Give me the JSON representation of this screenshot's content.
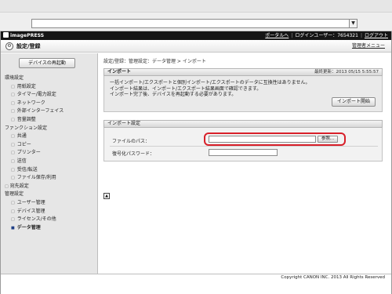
{
  "header": {
    "brand": "imagePRESS",
    "portal_link": "ポータルへ",
    "login_label": "ログインユーザー：7654321",
    "logout_link": "ログアウト"
  },
  "titlebar": {
    "title": "設定/登録",
    "admin_menu": "管理者メニュー"
  },
  "sidebar": {
    "restart_button": "デバイスの再起動",
    "items": [
      {
        "label": "環境設定",
        "level": 0
      },
      {
        "label": "用紙設定",
        "level": 1
      },
      {
        "label": "タイマー/電力設定",
        "level": 1
      },
      {
        "label": "ネットワーク",
        "level": 1
      },
      {
        "label": "外部インターフェイス",
        "level": 1
      },
      {
        "label": "音量調整",
        "level": 1
      },
      {
        "label": "ファンクション設定",
        "level": 0
      },
      {
        "label": "共通",
        "level": 1
      },
      {
        "label": "コピー",
        "level": 1
      },
      {
        "label": "プリンター",
        "level": 1
      },
      {
        "label": "送信",
        "level": 1
      },
      {
        "label": "受信/転送",
        "level": 1
      },
      {
        "label": "ファイル保存/利用",
        "level": 1
      },
      {
        "label": "宛先設定",
        "level": 0
      },
      {
        "label": "管理設定",
        "level": 0
      },
      {
        "label": "ユーザー管理",
        "level": 1
      },
      {
        "label": "デバイス管理",
        "level": 1
      },
      {
        "label": "ライセンス/その他",
        "level": 1
      },
      {
        "label": "データ管理",
        "level": 1,
        "active": true
      }
    ]
  },
  "main": {
    "breadcrumb": "設定/登録：管理設定：データ管理 > インポート",
    "import_panel": {
      "title": "インポート",
      "last_updated": "最終更新：2013 05/15 5:55:57",
      "messages": [
        "一括インポート/エクスポートと個別インポート/エクスポートのデータに互換性はありません。",
        "インポート結果は、インポート/エクスポート結果画面で確認できます。",
        "インポート完了後、デバイスを再起動する必要があります。"
      ],
      "start_button": "インポート開始"
    },
    "settings_panel": {
      "title": "インポート設定",
      "file_path_label": "ファイルのパス：",
      "file_path_value": "",
      "browse_button": "参照...",
      "password_label": "復号化パスワード：",
      "password_value": ""
    },
    "top_button": "▲"
  },
  "footer": {
    "copyright": "Copyright CANON INC. 2013 All Rights Reserved"
  },
  "colors": {
    "highlight": "#d8202a",
    "topbar": "#151515"
  }
}
